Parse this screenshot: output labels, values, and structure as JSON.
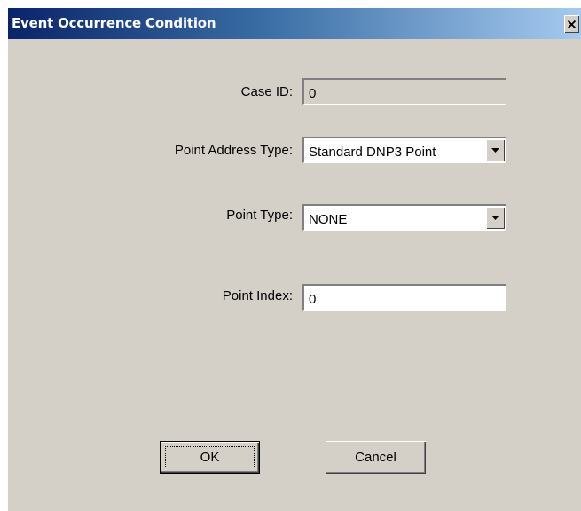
{
  "window": {
    "title": "Event Occurrence Condition",
    "close_icon": "close-icon"
  },
  "form": {
    "case_id": {
      "label": "Case ID:",
      "value": "0"
    },
    "point_address_type": {
      "label": "Point Address Type:",
      "value": "Standard DNP3 Point"
    },
    "point_type": {
      "label": "Point Type:",
      "value": "NONE"
    },
    "point_index": {
      "label": "Point Index:",
      "value": "0"
    }
  },
  "buttons": {
    "ok_label": "OK",
    "cancel_label": "Cancel"
  },
  "colors": {
    "dialog_background": "#d4d0c8",
    "titlebar_start": "#0a246a",
    "titlebar_end": "#a6caf0",
    "title_text": "#ffffff"
  }
}
